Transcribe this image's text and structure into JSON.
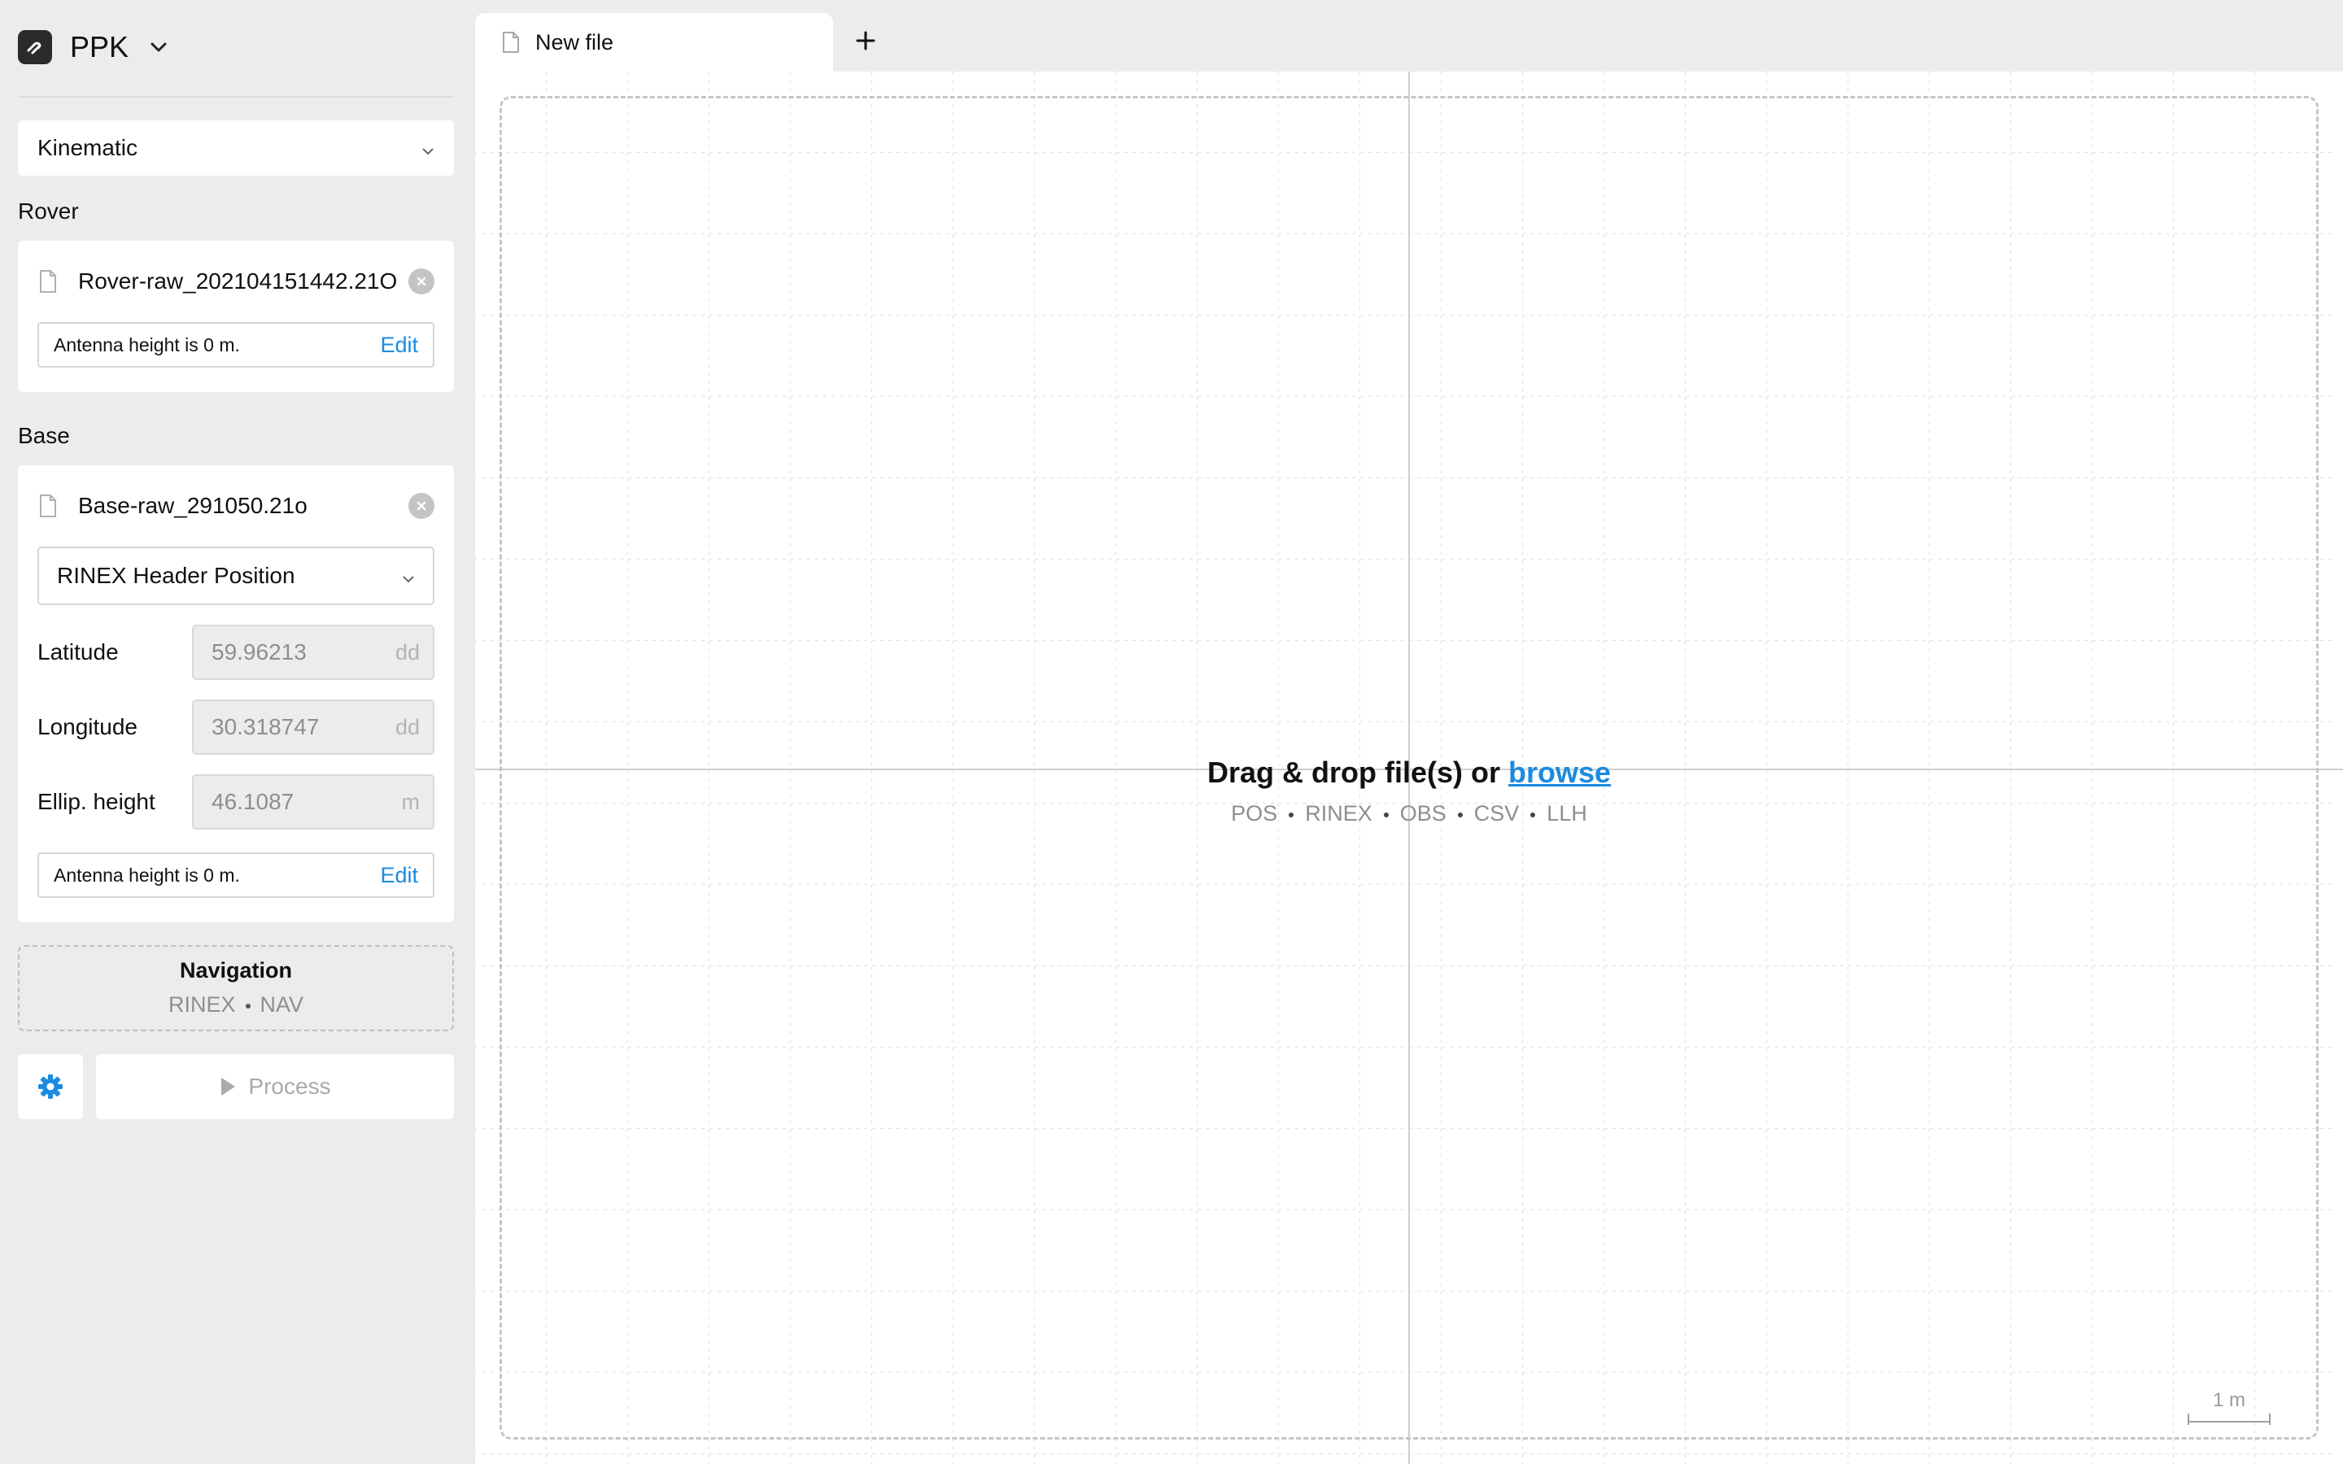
{
  "app": {
    "title": "PPK",
    "mode": "Kinematic"
  },
  "rover": {
    "section_label": "Rover",
    "file_name": "Rover-raw_202104151442.21O",
    "antenna_text": "Antenna height is 0 m.",
    "edit_label": "Edit"
  },
  "base": {
    "section_label": "Base",
    "file_name": "Base-raw_291050.21o",
    "position_source": "RINEX Header Position",
    "latitude": {
      "label": "Latitude",
      "value": "59.96213",
      "unit": "dd"
    },
    "longitude": {
      "label": "Longitude",
      "value": "30.318747",
      "unit": "dd"
    },
    "ellip_height": {
      "label": "Ellip. height",
      "value": "46.1087",
      "unit": "m"
    },
    "antenna_text": "Antenna height is 0 m.",
    "edit_label": "Edit"
  },
  "navigation": {
    "title": "Navigation",
    "formats": [
      "RINEX",
      "NAV"
    ]
  },
  "actions": {
    "process_label": "Process"
  },
  "tabs": [
    {
      "label": "New file"
    }
  ],
  "canvas": {
    "drop_text": "Drag & drop file(s) or ",
    "browse_label": "browse",
    "formats": [
      "POS",
      "RINEX",
      "OBS",
      "CSV",
      "LLH"
    ],
    "scale_label": "1 m"
  },
  "colors": {
    "accent": "#1a8be0",
    "sidebar_bg": "#ececec",
    "card_bg": "#ffffff"
  }
}
